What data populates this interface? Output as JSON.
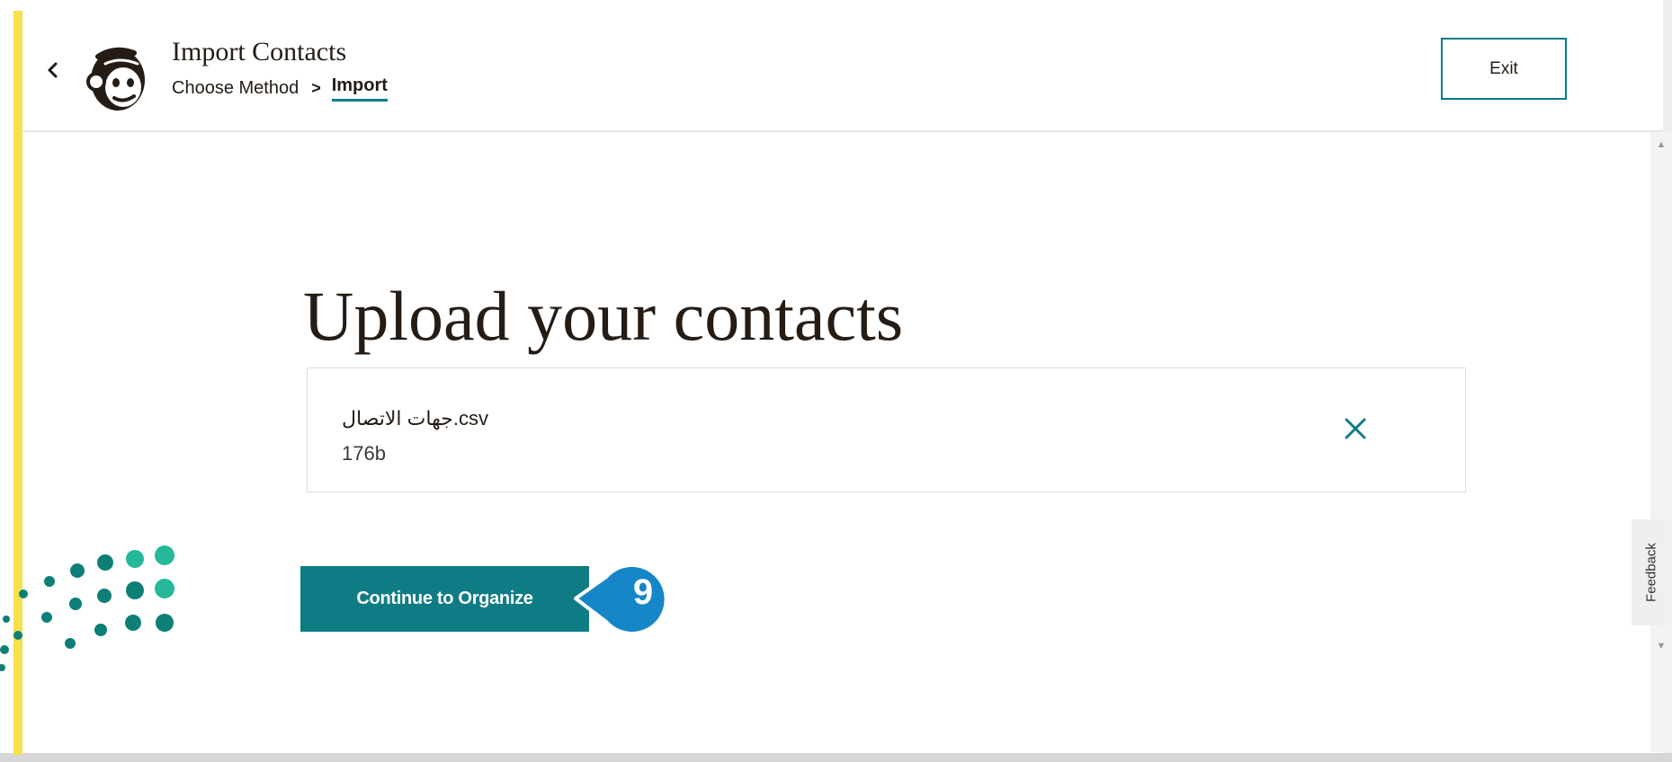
{
  "header": {
    "title": "Import Contacts",
    "breadcrumb": [
      {
        "label": "Choose Method",
        "current": false
      },
      {
        "label": "Import",
        "current": true
      }
    ],
    "breadcrumb_separator": ">",
    "exit_label": "Exit"
  },
  "main": {
    "heading": "Upload your contacts",
    "file": {
      "name": "جهات الاتصال.csv",
      "size": "176b"
    },
    "continue_label": "Continue to Organize"
  },
  "annotation": {
    "step_number": "9"
  },
  "feedback_label": "Feedback",
  "colors": {
    "accent": "#007c89",
    "button": "#0f7c85",
    "callout": "#1686c8",
    "yellow": "#f6e04b",
    "dots_dark": "#0d7f77",
    "dots_light": "#25b89a"
  },
  "icons": {
    "back": "chevron-left-icon",
    "logo": "freddie-logo",
    "remove": "close-icon"
  }
}
